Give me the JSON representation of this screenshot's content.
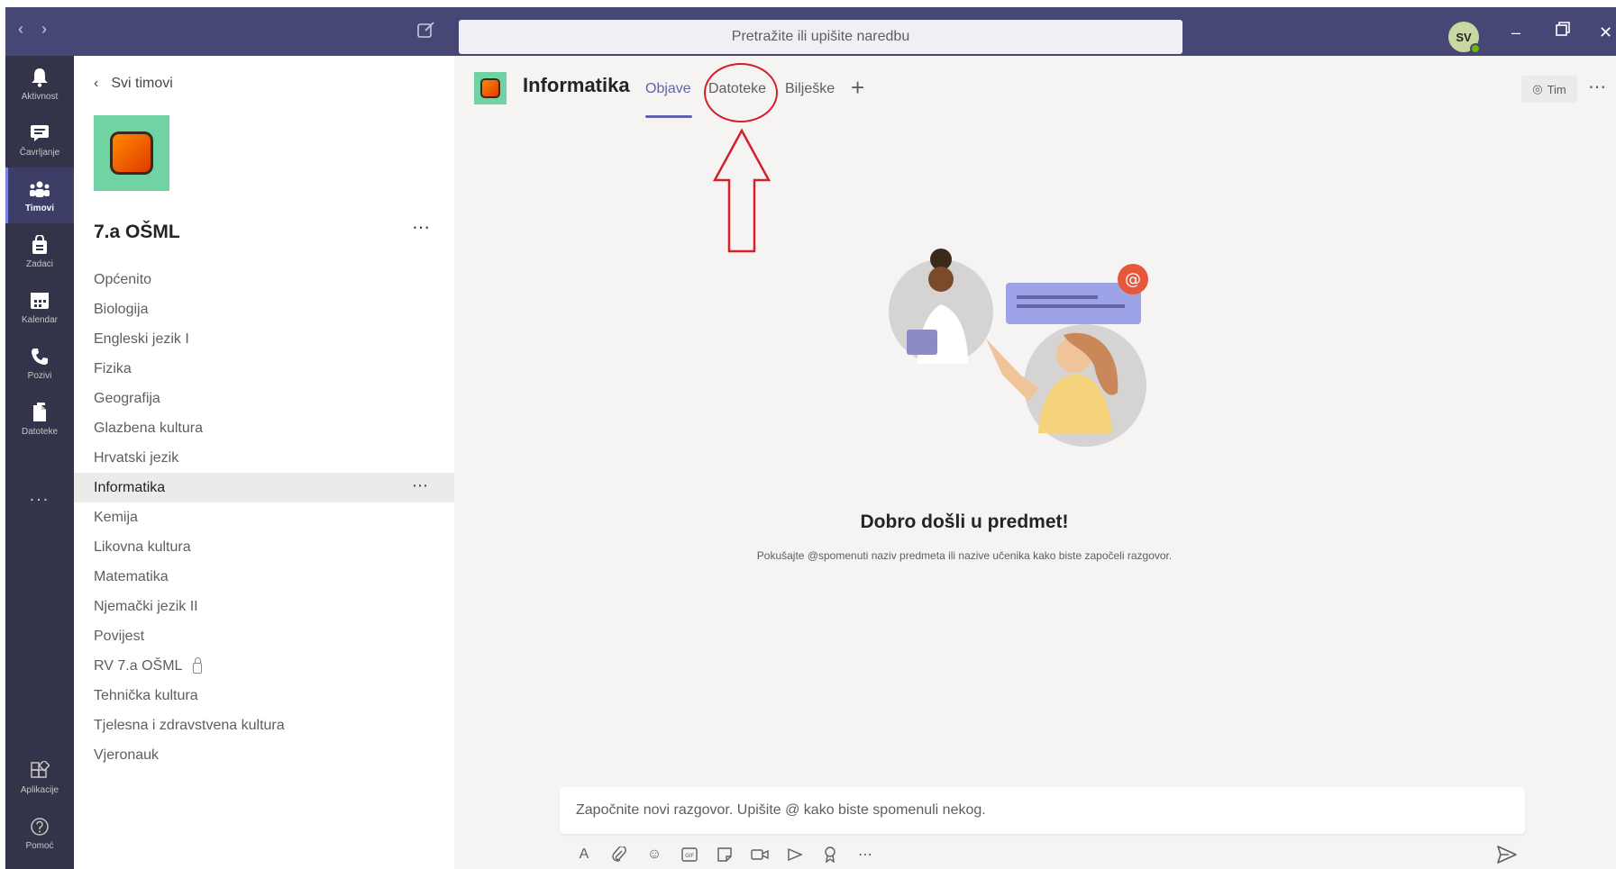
{
  "titlebar": {
    "search_placeholder": "Pretražite ili upišite naredbu",
    "avatar_initials": "SV"
  },
  "rail": {
    "items": [
      {
        "label": "Aktivnost",
        "icon": "bell-icon"
      },
      {
        "label": "Čavrljanje",
        "icon": "chat-icon"
      },
      {
        "label": "Timovi",
        "icon": "teams-icon"
      },
      {
        "label": "Zadaci",
        "icon": "assignments-icon"
      },
      {
        "label": "Kalendar",
        "icon": "calendar-icon"
      },
      {
        "label": "Pozivi",
        "icon": "phone-icon"
      },
      {
        "label": "Datoteke",
        "icon": "files-icon"
      }
    ],
    "more_label": "...",
    "bottom_items": [
      {
        "label": "Aplikacije",
        "icon": "apps-icon"
      },
      {
        "label": "Pomoć",
        "icon": "help-icon"
      }
    ]
  },
  "team_panel": {
    "back_label": "Svi timovi",
    "team_name": "7.a OŠML",
    "channels": [
      "Općenito",
      "Biologija",
      "Engleski jezik I",
      "Fizika",
      "Geografija",
      "Glazbena kultura",
      "Hrvatski jezik",
      "Informatika",
      "Kemija",
      "Likovna kultura",
      "Matematika",
      "Njemački jezik II",
      "Povijest",
      "RV 7.a OŠML",
      "Tehnička kultura",
      "Tjelesna i zdravstvena kultura",
      "Vjeronauk"
    ],
    "selected_channel": "Informatika",
    "private_channel": "RV 7.a OŠML"
  },
  "main": {
    "channel_title": "Informatika",
    "tabs": [
      {
        "label": "Objave",
        "active": true
      },
      {
        "label": "Datoteke",
        "active": false
      },
      {
        "label": "Bilješke",
        "active": false
      }
    ],
    "team_button_label": "Tim",
    "welcome_title": "Dobro došli u predmet!",
    "welcome_subtitle": "Pokušajte @spomenuti naziv predmeta ili nazive učenika kako biste započeli razgovor.",
    "compose_placeholder": "Započnite novi razgovor. Upišite @ kako biste spomenuli nekog.",
    "compose_tools": [
      "format-icon",
      "attach-icon",
      "emoji-icon",
      "gif-icon",
      "sticker-icon",
      "meet-icon",
      "stream-icon",
      "praise-icon",
      "more-icon"
    ]
  },
  "colors": {
    "titlebar": "#464775",
    "rail": "#33344a",
    "accent": "#6264a7",
    "annotation": "#d4202a",
    "team_logo_bg": "#6fd3a3"
  }
}
